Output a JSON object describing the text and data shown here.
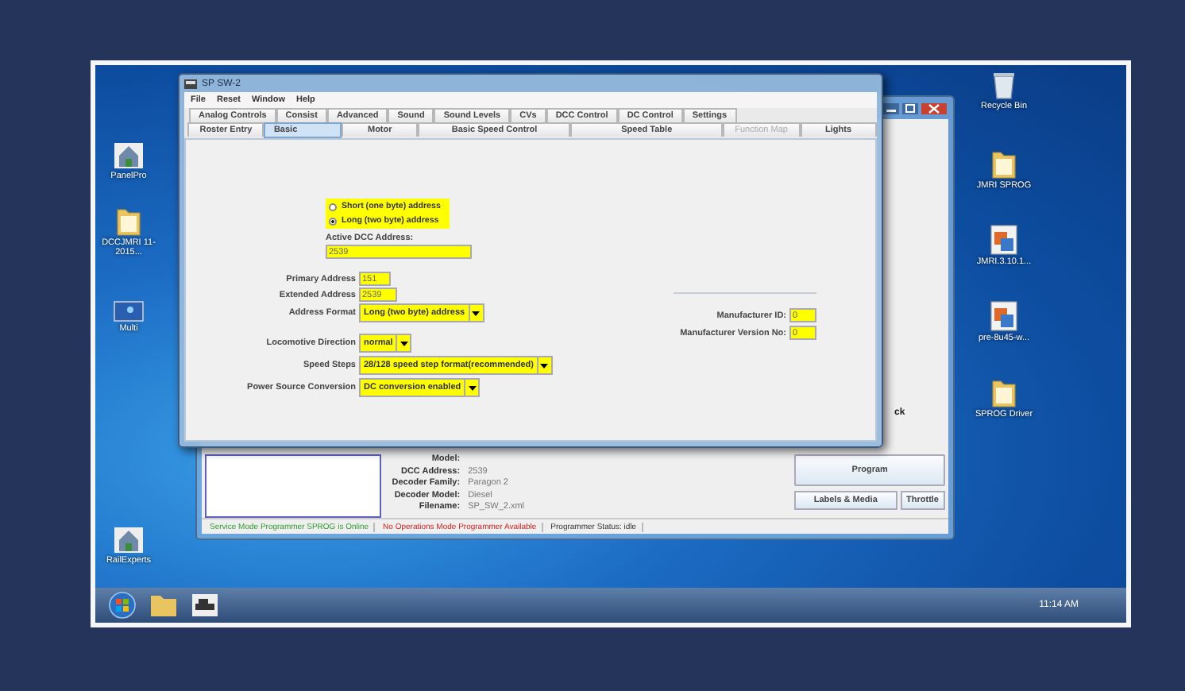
{
  "desktop": {
    "left_icons": [
      {
        "label": "PanelPro",
        "kind": "app"
      },
      {
        "label": "DCCJMRI 11-2015...",
        "kind": "folder"
      },
      {
        "label": "Multi",
        "kind": "window"
      },
      {
        "label": "RailExperts",
        "kind": "app"
      }
    ],
    "right_icons": [
      {
        "label": "Recycle Bin",
        "kind": "bin"
      },
      {
        "label": "JMRI SPROG",
        "kind": "folder"
      },
      {
        "label": "JMRI.3.10.1...",
        "kind": "program"
      },
      {
        "label": "pre-8u45-w...",
        "kind": "program"
      },
      {
        "label": "SPROG Driver",
        "kind": "folder"
      }
    ]
  },
  "back_window": {
    "partial_text": "ck",
    "roster_info": [
      {
        "label": "Model:"
      },
      {
        "label": "DCC Address:",
        "value": "2539"
      },
      {
        "label": "Decoder Family:",
        "value": "Paragon 2"
      },
      {
        "label": "Decoder Model:",
        "value": "Diesel"
      },
      {
        "label": "Filename:",
        "value": "SP_SW_2.xml"
      }
    ],
    "program_button": "Program",
    "buttons": [
      "Labels & Media",
      "Throttle"
    ],
    "status": [
      {
        "text": "Service Mode Programmer SPROG is Online",
        "color": "#2e9a2e"
      },
      {
        "text": "No Operations Mode Programmer Available",
        "color": "#d42020"
      },
      {
        "text": "Programmer Status:  idle"
      }
    ]
  },
  "window": {
    "title": "SP SW-2",
    "menu": [
      "File",
      "Reset",
      "Window",
      "Help"
    ],
    "tabs_row1": [
      {
        "label": "Analog Controls",
        "selected": false
      },
      {
        "label": "Consist",
        "selected": false
      },
      {
        "label": "Advanced",
        "selected": false
      },
      {
        "label": "Sound",
        "selected": false
      },
      {
        "label": "Sound Levels",
        "selected": false
      },
      {
        "label": "CVs",
        "selected": false
      },
      {
        "label": "DCC Control",
        "selected": false
      },
      {
        "label": "DC Control",
        "selected": false
      },
      {
        "label": "Settings",
        "selected": false
      }
    ],
    "tabs_row2": [
      {
        "label": "Roster Entry",
        "selected": false,
        "disabled": false
      },
      {
        "label": "Basic",
        "selected": true,
        "disabled": false
      },
      {
        "label": "Motor",
        "selected": false,
        "disabled": false
      },
      {
        "label": "Basic Speed Control",
        "selected": false,
        "disabled": false
      },
      {
        "label": "Speed Table",
        "selected": false,
        "disabled": false
      },
      {
        "label": "Function Map",
        "selected": false,
        "disabled": true
      },
      {
        "label": "Lights",
        "selected": false,
        "disabled": false
      }
    ],
    "address_mode": [
      {
        "label": "Short (one byte) address",
        "selected": false
      },
      {
        "label": "Long (two byte) address",
        "selected": true
      }
    ],
    "active_address": {
      "label": "Active DCC Address:",
      "value": "2539"
    },
    "address_fields": [
      {
        "label": "Primary Address",
        "value": "151",
        "kind": "text"
      },
      {
        "label": "Extended Address",
        "value": "2539",
        "kind": "text"
      },
      {
        "label": "Address Format",
        "value": "Long (two byte) address",
        "kind": "select"
      }
    ],
    "settings_fields": [
      {
        "label": "Locomotive Direction",
        "value": "normal",
        "kind": "select"
      },
      {
        "label": "Speed Steps",
        "value": "28/128 speed step format(recommended)",
        "kind": "select"
      },
      {
        "label": "Power Source Conversion",
        "value": "DC conversion enabled",
        "kind": "select"
      }
    ],
    "manufacturer": [
      {
        "label": "Manufacturer ID:",
        "value": "0"
      },
      {
        "label": "Manufacturer Version No:",
        "value": "0"
      }
    ]
  },
  "taskbar": {
    "clock": "11:14 AM"
  }
}
